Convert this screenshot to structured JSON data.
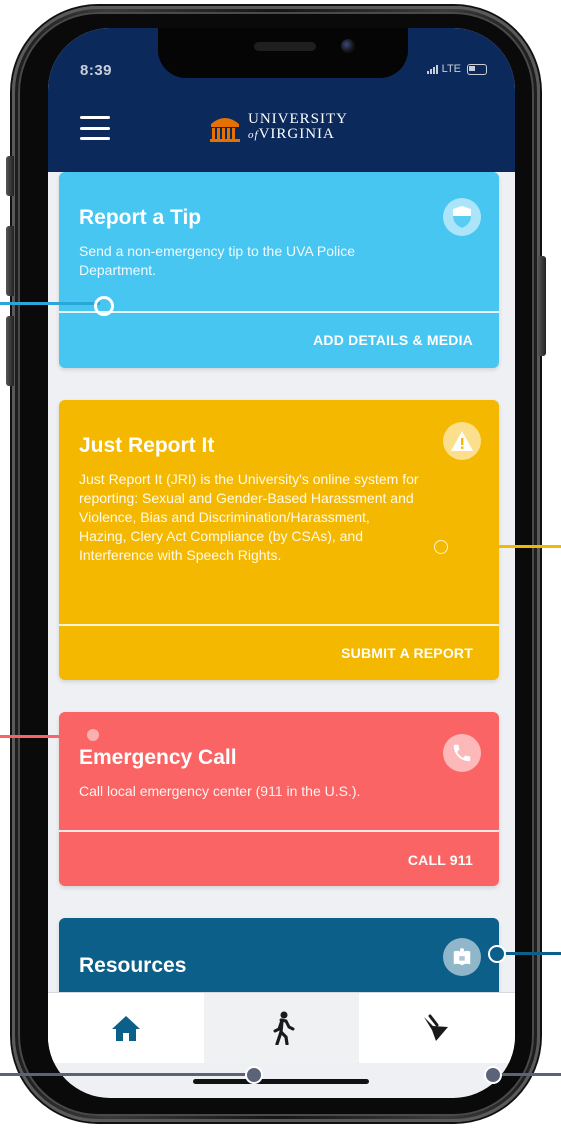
{
  "status_bar": {
    "time": "8:39",
    "network": "LTE"
  },
  "header": {
    "logo_line1": "UNIVERSITY",
    "logo_line2": "VIRGINIA",
    "logo_of": "of",
    "menu_icon": "hamburger-menu-icon"
  },
  "cards": {
    "tip": {
      "title": "Report a Tip",
      "description": "Send a non-emergency tip to the UVA Police Department.",
      "action": "ADD DETAILS & MEDIA",
      "icon": "shield-icon",
      "color": "#47c6f2"
    },
    "jri": {
      "title": "Just Report It",
      "description": "Just Report It (JRI) is the University's online system for reporting: Sexual and Gender-Based Harassment and Violence, Bias and Discrimination/Harassment, Hazing, Clery Act Compliance (by CSAs), and Interference with Speech Rights.",
      "action": "SUBMIT A REPORT",
      "icon": "warning-icon",
      "color": "#f5b800"
    },
    "emergency": {
      "title": "Emergency Call",
      "description": "Call local emergency center (911 in the U.S.).",
      "action": "CALL 911",
      "icon": "phone-icon",
      "color": "#fa6464"
    },
    "resources": {
      "title": "Resources",
      "icon": "book-icon",
      "color": "#0b5f88"
    }
  },
  "tabbar": {
    "tabs": [
      {
        "icon": "home-icon",
        "active": true
      },
      {
        "icon": "walking-person-icon",
        "active": false
      },
      {
        "icon": "megaphone-icon",
        "active": false
      }
    ]
  },
  "colors": {
    "header_bg": "#0b2a5b",
    "accent_blue": "#0b5f88",
    "screen_bg": "#eef0f3"
  }
}
